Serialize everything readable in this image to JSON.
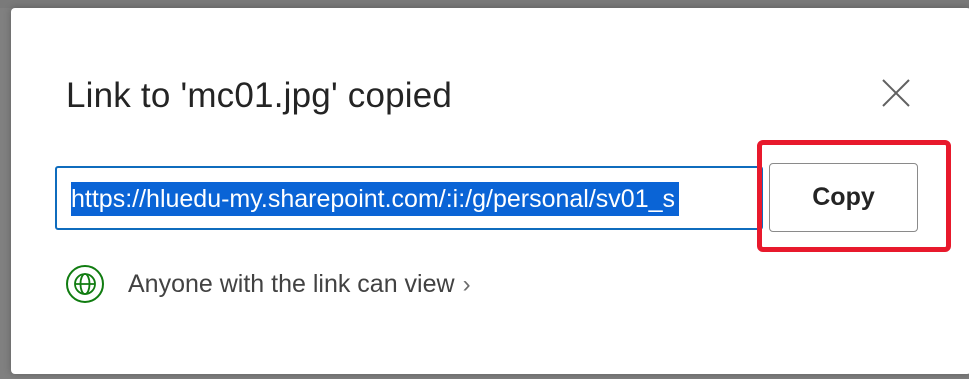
{
  "dialog": {
    "title": "Link to 'mc01.jpg' copied",
    "close_icon": "close-icon",
    "link": {
      "url": "https://hluedu-my.sharepoint.com/:i:/g/personal/sv01_s",
      "selected": true
    },
    "copy_button_label": "Copy",
    "access": {
      "icon": "globe-icon",
      "label": "Anyone with the link can view",
      "chevron": "›"
    }
  },
  "colors": {
    "accent_border": "#0f6cbd",
    "selection": "#0a64d6",
    "highlight_annotation": "#e8192c",
    "globe": "#107c10"
  }
}
